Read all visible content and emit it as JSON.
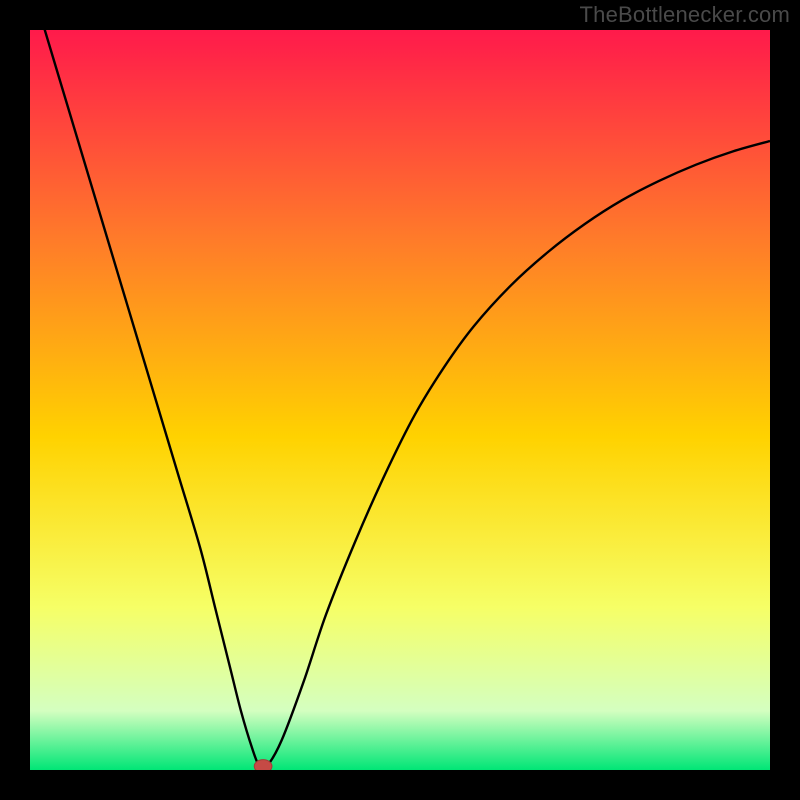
{
  "watermark": "TheBottlenecker.com",
  "colors": {
    "frame_bg": "#000000",
    "gradient_top": "#ff1a4b",
    "gradient_mid1": "#ff7a2a",
    "gradient_mid2": "#ffd200",
    "gradient_mid3": "#f6ff66",
    "gradient_mid4": "#d4ffc0",
    "gradient_bottom": "#00e676",
    "curve": "#000000",
    "marker_fill": "#c54a45",
    "marker_stroke": "#a33c38"
  },
  "chart_data": {
    "type": "line",
    "title": "",
    "xlabel": "",
    "ylabel": "",
    "xlim": [
      0,
      100
    ],
    "ylim": [
      0,
      100
    ],
    "grid": false,
    "legend": false,
    "series": [
      {
        "name": "bottleneck-curve",
        "x": [
          0,
          2,
          5,
          8,
          11,
          14,
          17,
          20,
          23,
          25,
          27,
          28.5,
          30,
          31,
          32,
          34,
          37,
          40,
          44,
          48,
          52,
          56,
          60,
          65,
          70,
          75,
          80,
          85,
          90,
          95,
          100
        ],
        "y": [
          107,
          100,
          90,
          80,
          70,
          60,
          50,
          40,
          30,
          22,
          14,
          8,
          3,
          0.5,
          0.5,
          4,
          12,
          21,
          31,
          40,
          48,
          54.5,
          60,
          65.5,
          70,
          73.8,
          77,
          79.6,
          81.8,
          83.6,
          85
        ]
      }
    ],
    "marker": {
      "x": 31.5,
      "y": 0.5,
      "rx": 1.2,
      "ry": 0.9
    }
  }
}
